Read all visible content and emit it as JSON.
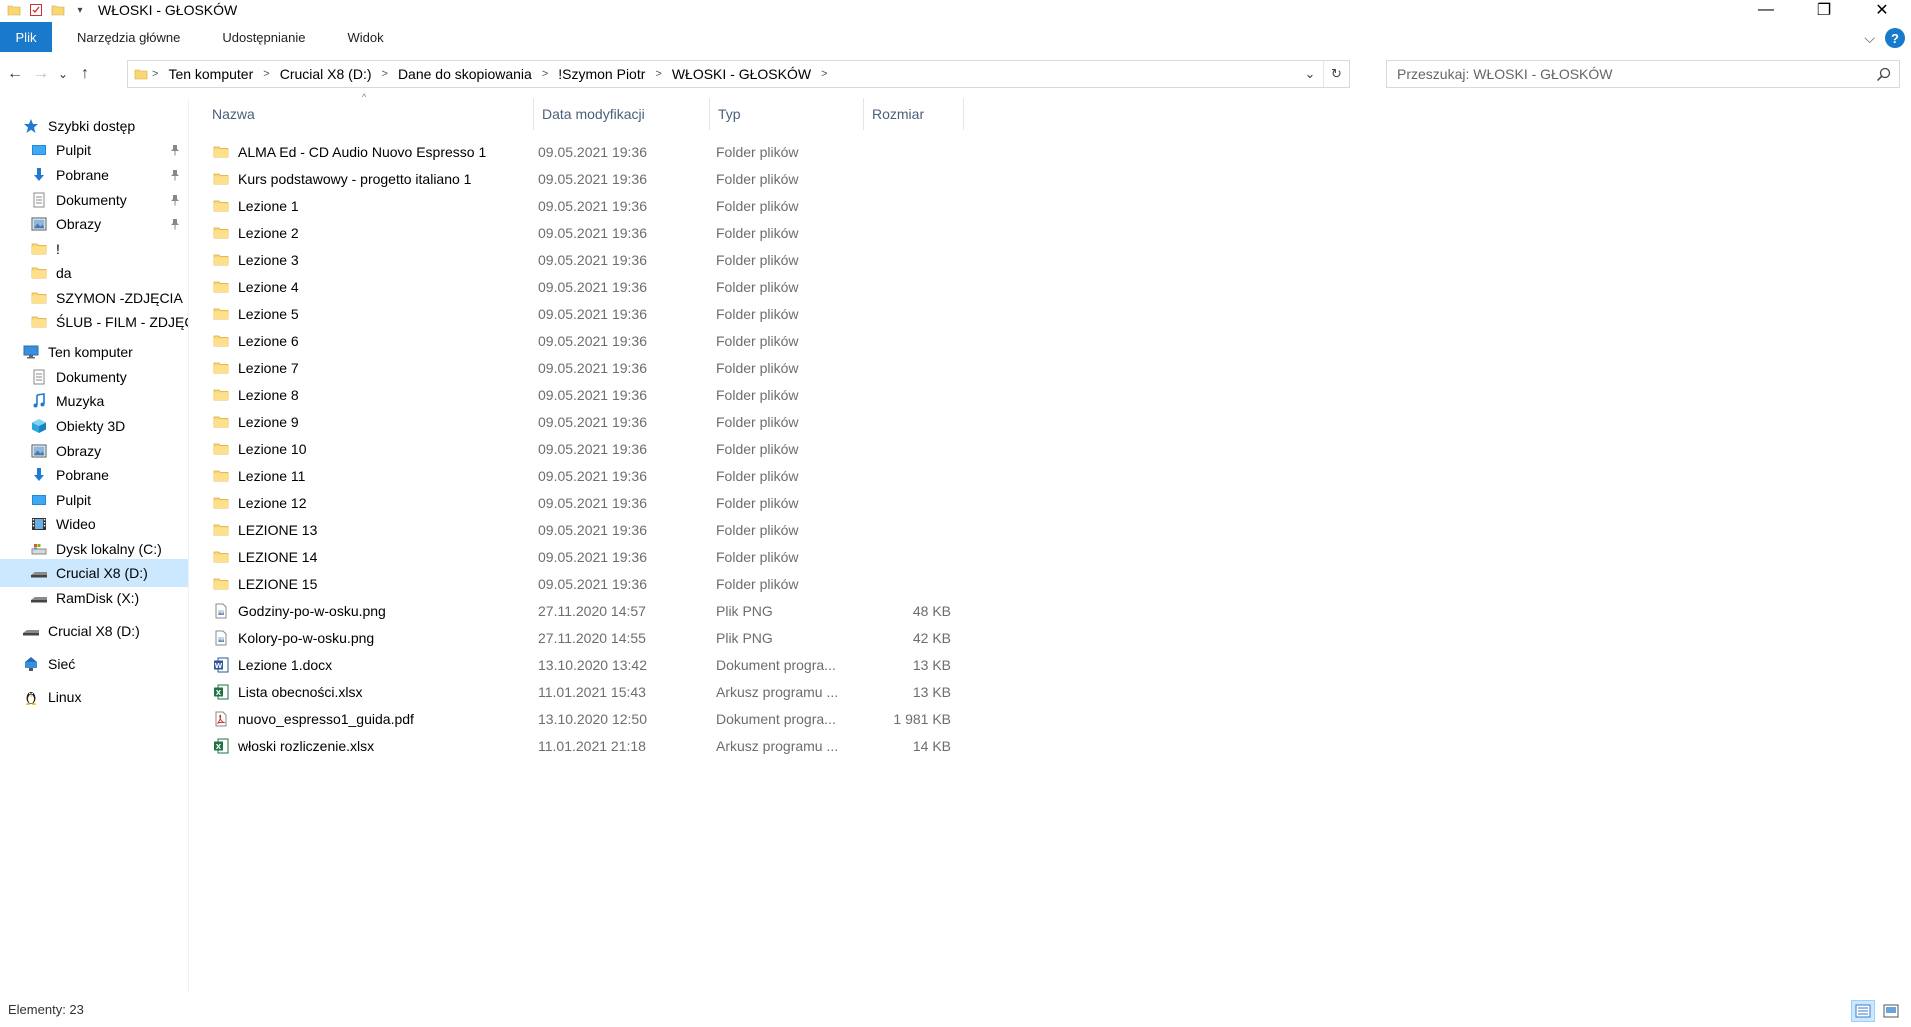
{
  "window": {
    "title": "WŁOSKI - GŁOSKÓW",
    "qa_dropdown": "▾",
    "controls": {
      "minimize": "—",
      "maximize": "❐",
      "close": "✕"
    }
  },
  "ribbon": {
    "file_tab": "Plik",
    "tabs": [
      "Narzędzia główne",
      "Udostępnianie",
      "Widok"
    ],
    "expand": "⌵",
    "help": "?"
  },
  "nav": {
    "back": "←",
    "forward": "→",
    "recent": "⌄",
    "up": "↑",
    "breadcrumbs": [
      "Ten komputer",
      "Crucial X8 (D:)",
      "Dane do skopiowania",
      "!Szymon Piotr",
      "WŁOSKI - GŁOSKÓW"
    ],
    "separator": ">",
    "dropdown": "⌄",
    "refresh": "↻"
  },
  "search": {
    "placeholder": "Przeszukaj: WŁOSKI - GŁOSKÓW"
  },
  "sidebar": {
    "items": [
      {
        "label": "Szybki dostęp",
        "icon": "star-icon",
        "level": "top",
        "pinned": false
      },
      {
        "label": "Pulpit",
        "icon": "desktop-icon",
        "level": "sub",
        "pinned": true
      },
      {
        "label": "Pobrane",
        "icon": "download-icon",
        "level": "sub",
        "pinned": true
      },
      {
        "label": "Dokumenty",
        "icon": "documents-icon",
        "level": "sub",
        "pinned": true
      },
      {
        "label": "Obrazy",
        "icon": "pictures-icon",
        "level": "sub",
        "pinned": true
      },
      {
        "label": "!",
        "icon": "folder-icon",
        "level": "sub",
        "pinned": false
      },
      {
        "label": "da",
        "icon": "folder-icon",
        "level": "sub",
        "pinned": false
      },
      {
        "label": "SZYMON -ZDJĘCIA",
        "icon": "folder-icon",
        "level": "sub",
        "pinned": false
      },
      {
        "label": "ŚLUB - FILM - ZDJĘCIA",
        "icon": "folder-icon",
        "level": "sub",
        "pinned": false
      },
      {
        "label": "Ten komputer",
        "icon": "computer-icon",
        "level": "top",
        "pinned": false
      },
      {
        "label": "Dokumenty",
        "icon": "documents-icon",
        "level": "sub",
        "pinned": false
      },
      {
        "label": "Muzyka",
        "icon": "music-icon",
        "level": "sub",
        "pinned": false
      },
      {
        "label": "Obiekty 3D",
        "icon": "3d-objects-icon",
        "level": "sub",
        "pinned": false
      },
      {
        "label": "Obrazy",
        "icon": "pictures-icon",
        "level": "sub",
        "pinned": false
      },
      {
        "label": "Pobrane",
        "icon": "download-icon",
        "level": "sub",
        "pinned": false
      },
      {
        "label": "Pulpit",
        "icon": "desktop-icon",
        "level": "sub",
        "pinned": false
      },
      {
        "label": "Wideo",
        "icon": "video-icon",
        "level": "sub",
        "pinned": false
      },
      {
        "label": "Dysk lokalny (C:)",
        "icon": "local-disk-icon",
        "level": "sub",
        "pinned": false
      },
      {
        "label": "Crucial X8 (D:)",
        "icon": "usb-drive-icon",
        "level": "sub",
        "pinned": false,
        "selected": true
      },
      {
        "label": "RamDisk (X:)",
        "icon": "usb-drive-icon",
        "level": "sub",
        "pinned": false
      },
      {
        "label": "Crucial X8 (D:)",
        "icon": "usb-drive-icon",
        "level": "top",
        "pinned": false
      },
      {
        "label": "Sieć",
        "icon": "network-icon",
        "level": "top",
        "pinned": false
      },
      {
        "label": "Linux",
        "icon": "linux-icon",
        "level": "top",
        "pinned": false
      }
    ]
  },
  "files": {
    "columns": [
      "Nazwa",
      "Data modyfikacji",
      "Typ",
      "Rozmiar"
    ],
    "sort_indicator": "^",
    "rows": [
      {
        "name": "ALMA Ed - CD Audio Nuovo Espresso 1",
        "date": "09.05.2021 19:36",
        "type": "Folder plików",
        "size": "",
        "icon": "folder-icon"
      },
      {
        "name": "Kurs podstawowy - progetto italiano 1",
        "date": "09.05.2021 19:36",
        "type": "Folder plików",
        "size": "",
        "icon": "folder-icon"
      },
      {
        "name": "Lezione 1",
        "date": "09.05.2021 19:36",
        "type": "Folder plików",
        "size": "",
        "icon": "folder-icon"
      },
      {
        "name": "Lezione 2",
        "date": "09.05.2021 19:36",
        "type": "Folder plików",
        "size": "",
        "icon": "folder-icon"
      },
      {
        "name": "Lezione 3",
        "date": "09.05.2021 19:36",
        "type": "Folder plików",
        "size": "",
        "icon": "folder-icon"
      },
      {
        "name": "Lezione 4",
        "date": "09.05.2021 19:36",
        "type": "Folder plików",
        "size": "",
        "icon": "folder-icon"
      },
      {
        "name": "Lezione 5",
        "date": "09.05.2021 19:36",
        "type": "Folder plików",
        "size": "",
        "icon": "folder-icon"
      },
      {
        "name": "Lezione 6",
        "date": "09.05.2021 19:36",
        "type": "Folder plików",
        "size": "",
        "icon": "folder-icon"
      },
      {
        "name": "Lezione 7",
        "date": "09.05.2021 19:36",
        "type": "Folder plików",
        "size": "",
        "icon": "folder-icon"
      },
      {
        "name": "Lezione 8",
        "date": "09.05.2021 19:36",
        "type": "Folder plików",
        "size": "",
        "icon": "folder-icon"
      },
      {
        "name": "Lezione 9",
        "date": "09.05.2021 19:36",
        "type": "Folder plików",
        "size": "",
        "icon": "folder-icon"
      },
      {
        "name": "Lezione 10",
        "date": "09.05.2021 19:36",
        "type": "Folder plików",
        "size": "",
        "icon": "folder-icon"
      },
      {
        "name": "Lezione 11",
        "date": "09.05.2021 19:36",
        "type": "Folder plików",
        "size": "",
        "icon": "folder-icon"
      },
      {
        "name": "Lezione 12",
        "date": "09.05.2021 19:36",
        "type": "Folder plików",
        "size": "",
        "icon": "folder-icon"
      },
      {
        "name": "LEZIONE 13",
        "date": "09.05.2021 19:36",
        "type": "Folder plików",
        "size": "",
        "icon": "folder-icon"
      },
      {
        "name": "LEZIONE 14",
        "date": "09.05.2021 19:36",
        "type": "Folder plików",
        "size": "",
        "icon": "folder-icon"
      },
      {
        "name": "LEZIONE 15",
        "date": "09.05.2021 19:36",
        "type": "Folder plików",
        "size": "",
        "icon": "folder-icon"
      },
      {
        "name": "Godziny-po-w-osku.png",
        "date": "27.11.2020 14:57",
        "type": "Plik PNG",
        "size": "48 KB",
        "icon": "image-file-icon"
      },
      {
        "name": "Kolory-po-w-osku.png",
        "date": "27.11.2020 14:55",
        "type": "Plik PNG",
        "size": "42 KB",
        "icon": "image-file-icon"
      },
      {
        "name": "Lezione 1.docx",
        "date": "13.10.2020 13:42",
        "type": "Dokument progra...",
        "size": "13 KB",
        "icon": "word-file-icon"
      },
      {
        "name": "Lista obecności.xlsx",
        "date": "11.01.2021 15:43",
        "type": "Arkusz programu ...",
        "size": "13 KB",
        "icon": "excel-file-icon"
      },
      {
        "name": "nuovo_espresso1_guida.pdf",
        "date": "13.10.2020 12:50",
        "type": "Dokument progra...",
        "size": "1 981 KB",
        "icon": "pdf-file-icon"
      },
      {
        "name": "włoski rozliczenie.xlsx",
        "date": "11.01.2021 21:18",
        "type": "Arkusz programu ...",
        "size": "14 KB",
        "icon": "excel-file-icon"
      }
    ]
  },
  "status": {
    "text": "Elementy: 23"
  },
  "colors": {
    "accent": "#1979ca",
    "folder": "#f8d775",
    "selected": "#cce8ff"
  }
}
